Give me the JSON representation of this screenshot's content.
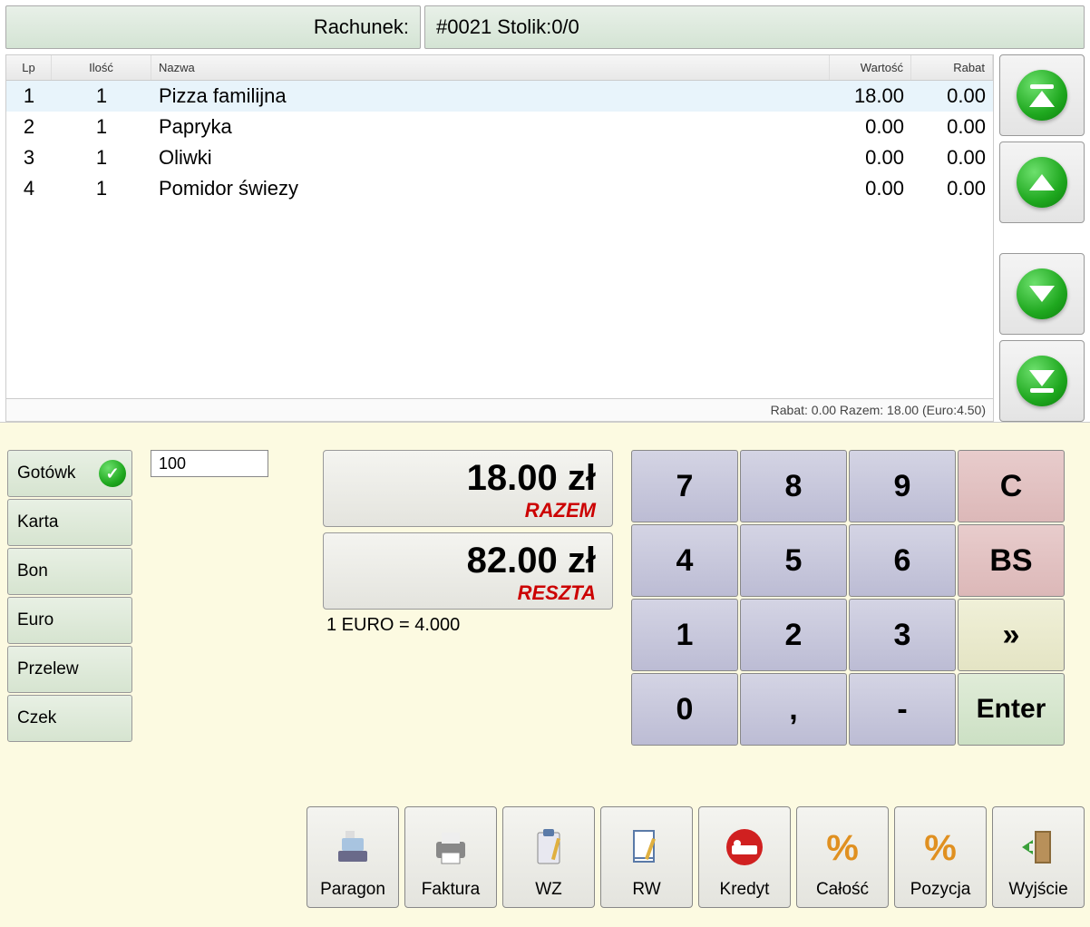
{
  "header": {
    "left_label": "Rachunek:",
    "right_label": "#0021 Stolik:0/0"
  },
  "grid": {
    "columns": {
      "lp": "Lp",
      "ilosc": "Ilość",
      "nazwa": "Nazwa",
      "wartosc": "Wartość",
      "rabat": "Rabat"
    },
    "rows": [
      {
        "lp": "1",
        "ilosc": "1",
        "nazwa": "Pizza familijna",
        "wartosc": "18.00",
        "rabat": "0.00",
        "selected": true
      },
      {
        "lp": "2",
        "ilosc": "1",
        "nazwa": "Papryka",
        "wartosc": "0.00",
        "rabat": "0.00"
      },
      {
        "lp": "3",
        "ilosc": "1",
        "nazwa": "Oliwki",
        "wartosc": "0.00",
        "rabat": "0.00"
      },
      {
        "lp": "4",
        "ilosc": "1",
        "nazwa": "Pomidor świezy",
        "wartosc": "0.00",
        "rabat": "0.00"
      }
    ],
    "footer": "Rabat: 0.00 Razem: 18.00 (Euro:4.50)"
  },
  "payment_methods": [
    {
      "label": "Gotówk",
      "checked": true
    },
    {
      "label": "Karta"
    },
    {
      "label": "Bon"
    },
    {
      "label": "Euro"
    },
    {
      "label": "Przelew"
    },
    {
      "label": "Czek"
    }
  ],
  "amount_input": "100",
  "totals": {
    "razem_value": "18.00 zł",
    "razem_label": "RAZEM",
    "reszta_value": "82.00 zł",
    "reszta_label": "RESZTA",
    "euro_rate": "1 EURO = 4.000"
  },
  "keypad": {
    "k7": "7",
    "k8": "8",
    "k9": "9",
    "kc": "C",
    "k4": "4",
    "k5": "5",
    "k6": "6",
    "kbs": "BS",
    "k1": "1",
    "k2": "2",
    "k3": "3",
    "kfwd": "»",
    "k0": "0",
    "kcomma": ",",
    "kdash": "-",
    "kenter": "Enter"
  },
  "actions": [
    {
      "label": "Paragon",
      "icon": "cash-register-icon"
    },
    {
      "label": "Faktura",
      "icon": "printer-icon"
    },
    {
      "label": "WZ",
      "icon": "clipboard-icon"
    },
    {
      "label": "RW",
      "icon": "document-edit-icon"
    },
    {
      "label": "Kredyt",
      "icon": "bed-icon"
    },
    {
      "label": "Całość",
      "icon": "percent-icon"
    },
    {
      "label": "Pozycja",
      "icon": "percent-icon"
    },
    {
      "label": "Wyjście",
      "icon": "exit-door-icon"
    }
  ]
}
